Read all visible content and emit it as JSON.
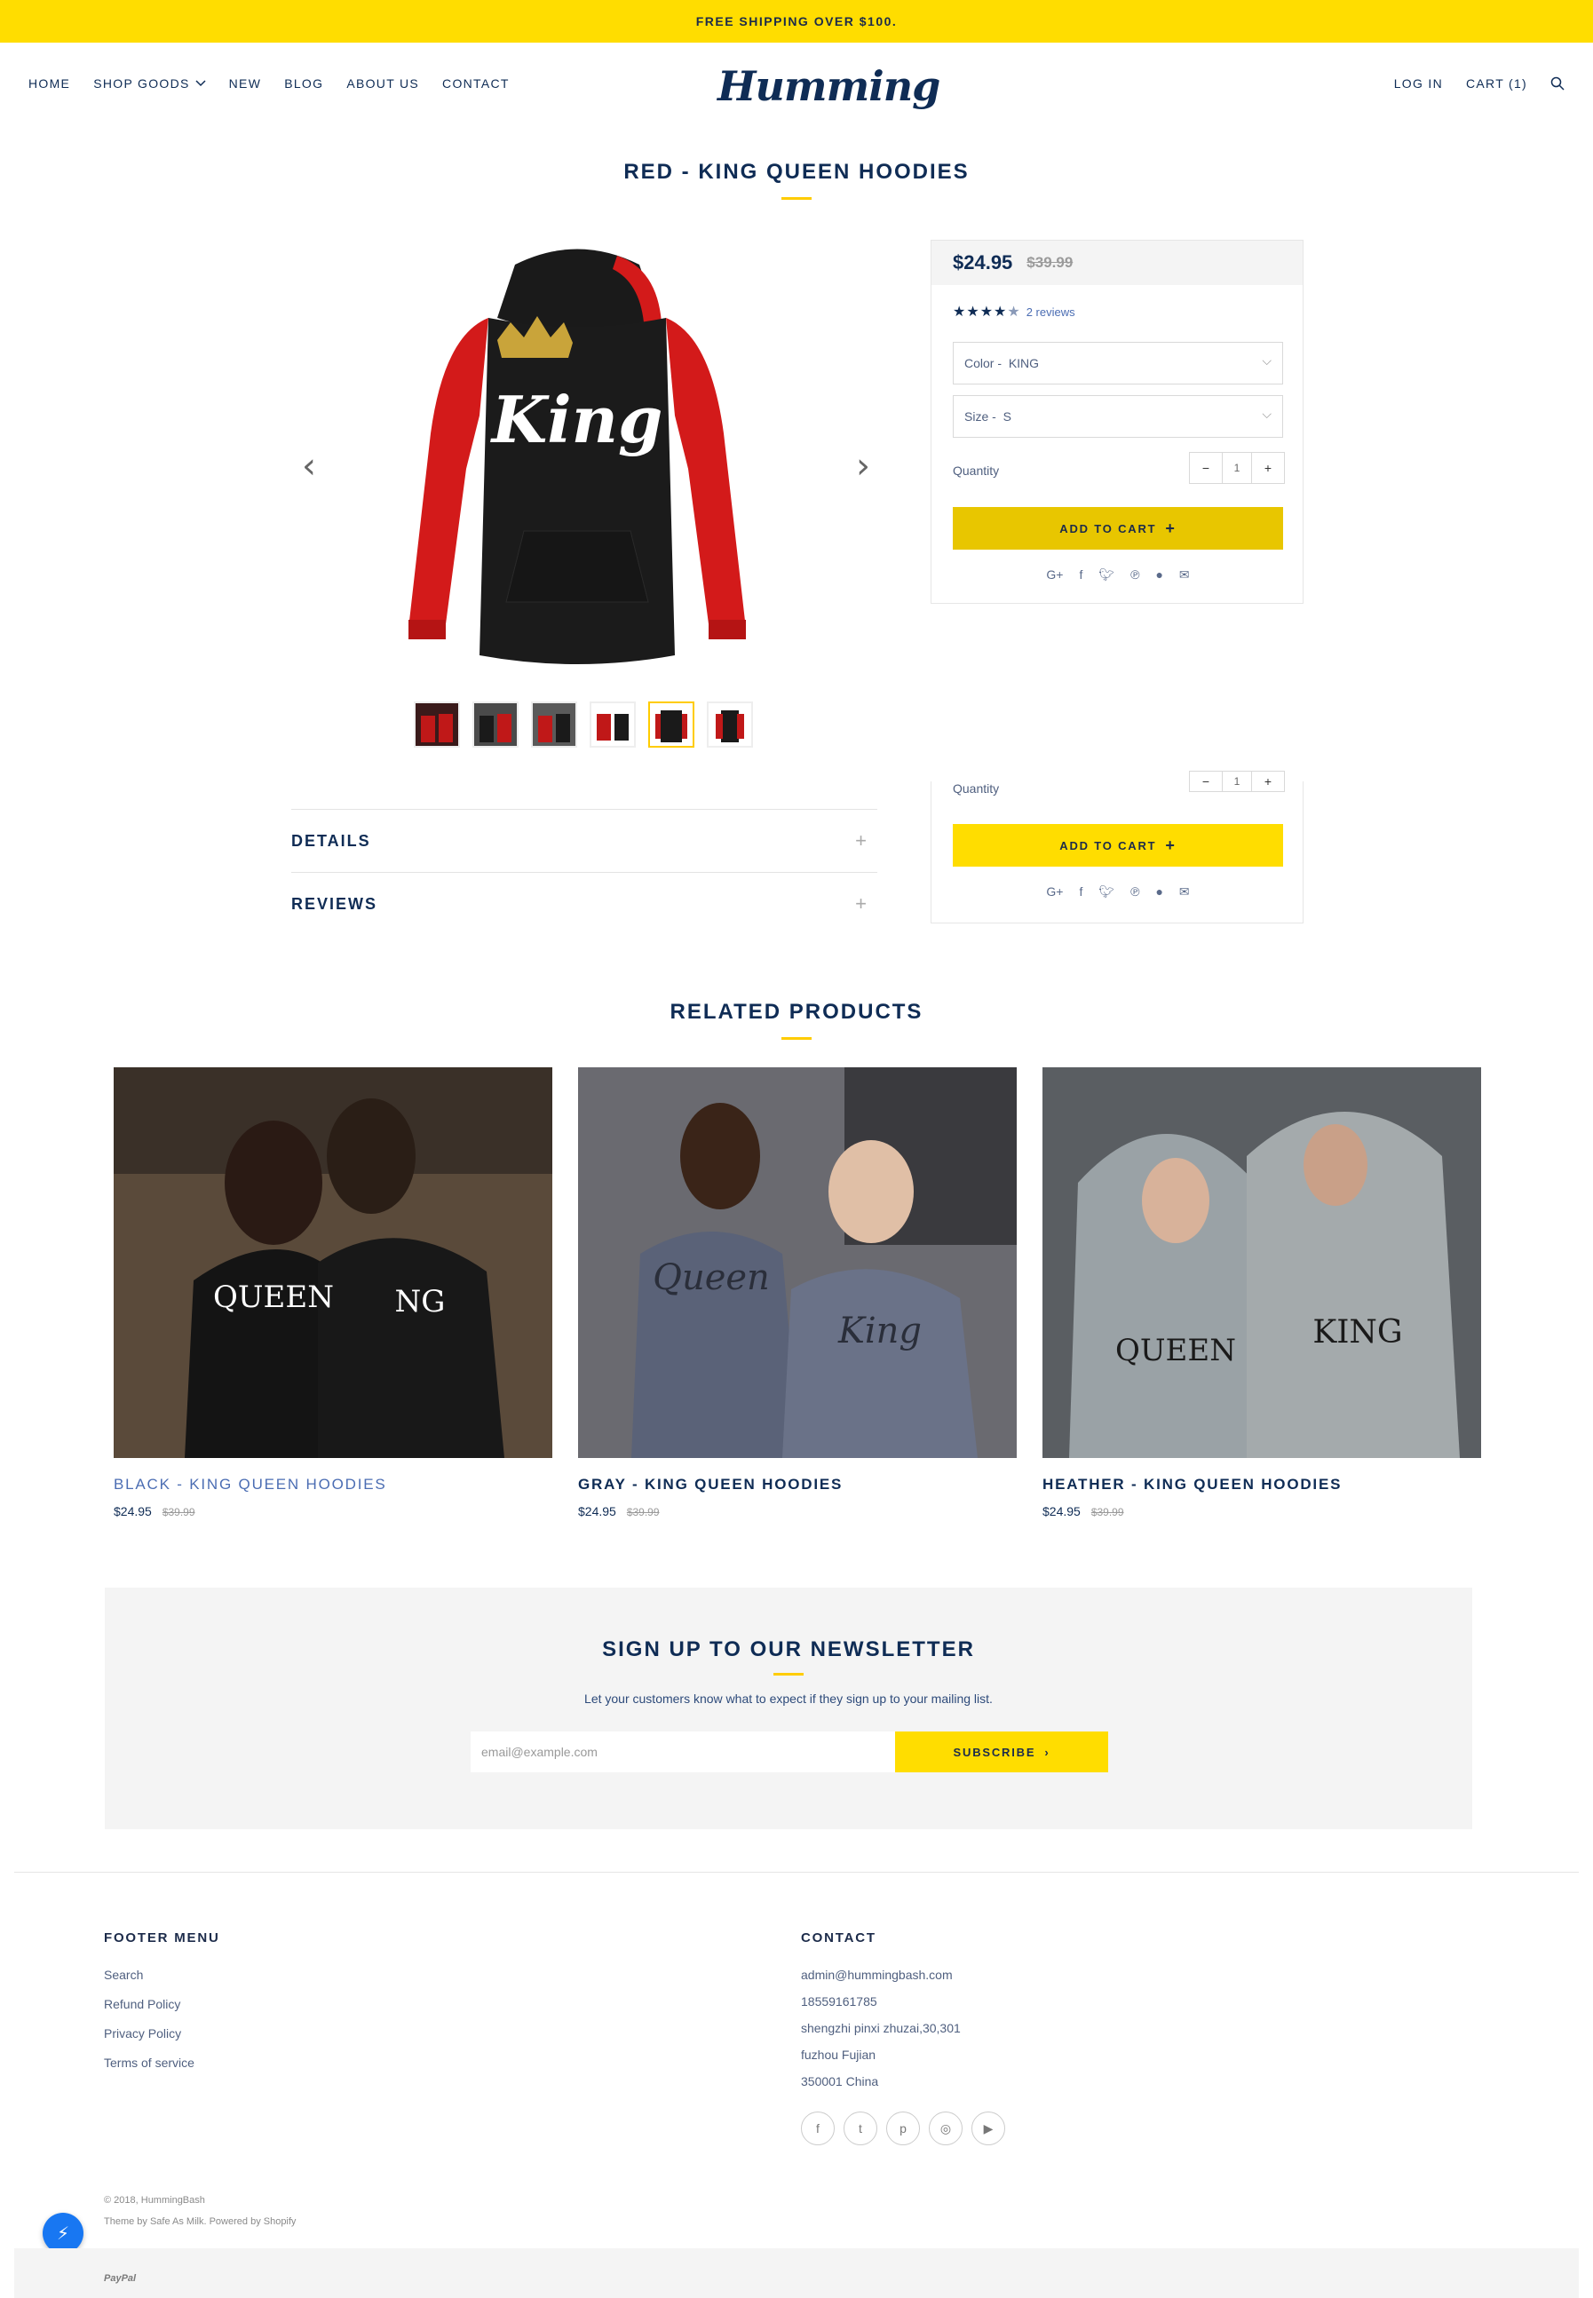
{
  "announcement": "FREE SHIPPING OVER $100.",
  "nav": {
    "items": [
      "HOME",
      "SHOP GOODS",
      "NEW",
      "BLOG",
      "ABOUT US",
      "CONTACT"
    ],
    "logo": "Humming",
    "login": "LOG IN",
    "cart": "CART (1)"
  },
  "product": {
    "title": "RED - KING QUEEN HOODIES",
    "price": "$24.95",
    "compare_price": "$39.99",
    "rating_stars": 4.5,
    "reviews_link": "2 reviews",
    "color_label": "Color",
    "color_value": "KING",
    "size_label": "Size",
    "size_value": "S",
    "quantity_label": "Quantity",
    "quantity": "1",
    "add_to_cart": "ADD TO CART",
    "details": "DETAILS",
    "reviews": "REVIEWS",
    "thumbs_active_index": 4,
    "icons": [
      "google-plus-icon",
      "facebook-icon",
      "twitter-icon",
      "pinterest-icon",
      "fancy-icon",
      "email-icon"
    ]
  },
  "related": {
    "title": "RELATED PRODUCTS",
    "items": [
      {
        "title": "BLACK - KING QUEEN HOODIES",
        "price": "$24.95",
        "compare": "$39.99"
      },
      {
        "title": "GRAY - KING QUEEN HOODIES",
        "price": "$24.95",
        "compare": "$39.99"
      },
      {
        "title": "HEATHER - KING QUEEN HOODIES",
        "price": "$24.95",
        "compare": "$39.99"
      }
    ]
  },
  "newsletter": {
    "title": "SIGN UP TO OUR NEWSLETTER",
    "subtitle": "Let your customers know what to expect if they sign up to your mailing list.",
    "placeholder": "email@example.com",
    "button": "SUBSCRIBE"
  },
  "footer": {
    "menu_title": "FOOTER MENU",
    "menu_links": [
      "Search",
      "Refund Policy",
      "Privacy Policy",
      "Terms of service"
    ],
    "contact_title": "CONTACT",
    "contact_lines": [
      "admin@hummingbash.com",
      "18559161785",
      "shengzhi pinxi zhuzai,30,301",
      "fuzhou Fujian",
      "350001 China"
    ],
    "copyright": "© 2018, HummingBash",
    "powered": "Theme by Safe As Milk. Powered by Shopify",
    "payment": "PayPal"
  },
  "colors": {
    "accent": "#ffdd00",
    "navy": "#0f2c55"
  }
}
